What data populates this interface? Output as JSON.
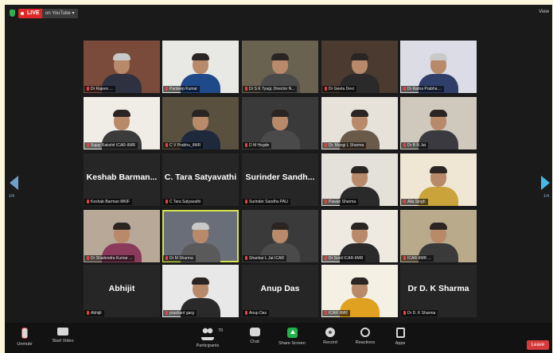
{
  "topbar": {
    "live_label": "LIVE",
    "stream_label": "on YouTube",
    "view_label": "View"
  },
  "tiles": [
    {
      "name": "Dr Rajeev ...",
      "kind": "video",
      "bg": "#7a4a3a",
      "shirt": "#2d3140",
      "grey": true
    },
    {
      "name": "Pardeep Kumar",
      "kind": "video",
      "bg": "#e8e8e4",
      "shirt": "#1f4a8a",
      "grey": false
    },
    {
      "name": "Dr S K Tyagi, Director N...",
      "kind": "video",
      "bg": "#6a6250",
      "shirt": "#4a4a4a",
      "grey": false
    },
    {
      "name": "Dr Geeta Devi",
      "kind": "video",
      "bg": "#4a3a30",
      "shirt": "#2a2a2a",
      "grey": false
    },
    {
      "name": "Dr Ratna Prabha ...",
      "kind": "video",
      "bg": "#dcdce6",
      "shirt": "#2f3f6a",
      "grey": true
    },
    {
      "name": "Sujay Rakshit ICAR-IIMR",
      "kind": "video",
      "bg": "#f0ece6",
      "shirt": "#3b3b3b",
      "grey": false
    },
    {
      "name": "C V Prabhu_IIMR",
      "kind": "video",
      "bg": "#5a5040",
      "shirt": "#1e2a3c",
      "grey": false
    },
    {
      "name": "D M Hegde",
      "kind": "video",
      "bg": "#3a3a3a",
      "shirt": "#4a4a4a",
      "grey": false
    },
    {
      "name": "Dr. Mangi L Sharma",
      "kind": "video",
      "bg": "#e6e2da",
      "shirt": "#6a5a4a",
      "grey": false
    },
    {
      "name": "Dr B N Jat",
      "kind": "video",
      "bg": "#cfc8bc",
      "shirt": "#3a3a40",
      "grey": false
    },
    {
      "name": "Keshab Barman MKIF",
      "big": "Keshab Barman...",
      "kind": "name"
    },
    {
      "name": "C Tara Satyavathi",
      "big": "C. Tara Satyavathi",
      "kind": "name"
    },
    {
      "name": "Surinder Sandhu PAU",
      "big": "Surinder Sandh...",
      "kind": "name"
    },
    {
      "name": "Pawan Sharma",
      "kind": "video",
      "bg": "#e4e0da",
      "shirt": "#2a2a2a",
      "grey": false
    },
    {
      "name": "Alla Singh",
      "kind": "video",
      "bg": "#efe6d4",
      "shirt": "#caa43a",
      "grey": false
    },
    {
      "name": "Dr Shailendra Kumar ...",
      "kind": "video",
      "bg": "#b8a898",
      "shirt": "#8a3a5a",
      "grey": false
    },
    {
      "name": "Dr M Sharma",
      "kind": "video",
      "bg": "#6a6e78",
      "shirt": "#5a5a5a",
      "grey": true,
      "active": true
    },
    {
      "name": "Shankar L Jat ICAR",
      "kind": "video",
      "bg": "#3a3a3a",
      "shirt": "#4a4a4a",
      "grey": false
    },
    {
      "name": "Dr Sunil ICAR-IIMR",
      "kind": "video",
      "bg": "#eeeae2",
      "shirt": "#2a2a2a",
      "grey": false
    },
    {
      "name": "ICAR-IIMR ...",
      "kind": "video",
      "bg": "#b8aa8a",
      "shirt": "#3a3a3a",
      "grey": false
    },
    {
      "name": "Abhijit",
      "big": "Abhijit",
      "kind": "name"
    },
    {
      "name": "prashant garg",
      "kind": "video",
      "bg": "#e8e8e8",
      "shirt": "#2a2a2a",
      "grey": false
    },
    {
      "name": "Anup Das",
      "big": "Anup Das",
      "kind": "name"
    },
    {
      "name": "ICAR IIMR",
      "kind": "video",
      "bg": "#f4f0e4",
      "shirt": "#e0a020",
      "grey": false
    },
    {
      "name": "Dr D. K Sharma",
      "big": "Dr D. K Sharma",
      "kind": "name"
    }
  ],
  "nav": {
    "page_left": "1/4",
    "page_right": "1/4"
  },
  "toolbar": {
    "unmute": "Unmute",
    "start_video": "Start Video",
    "participants": "Participants",
    "participants_count": "70",
    "chat": "Chat",
    "share_screen": "Share Screen",
    "record": "Record",
    "reactions": "Reactions",
    "apps": "Apps",
    "leave": "Leave"
  }
}
